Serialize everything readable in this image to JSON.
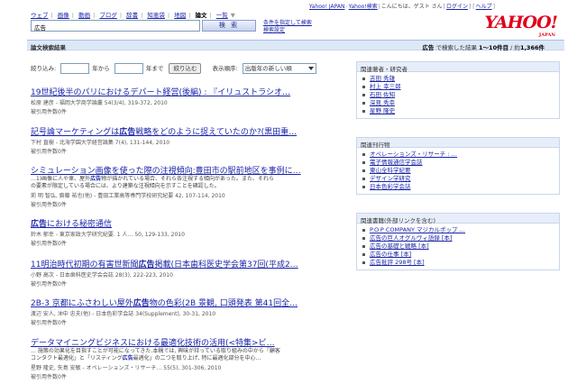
{
  "header": {
    "top_links": [
      "Yahoo! JAPAN",
      "Yahoo!検索",
      "こんにちは、ゲスト さん",
      "ログイン",
      "ヘルプ"
    ],
    "logo": "YAHOO!",
    "logo_sub": "JAPAN",
    "tabs": [
      "ウェブ",
      "画像",
      "動画",
      "ブログ",
      "辞書",
      "知恵袋",
      "地図",
      "論文",
      "一覧"
    ],
    "active_tab": "論文",
    "search_value": "広告",
    "search_button": "検 索",
    "advanced_links": [
      "条件を指定して検索",
      "検索設定"
    ]
  },
  "results_bar": {
    "title": "論文検索結果",
    "query": "広告",
    "summary": "で検索した結果",
    "range": "1〜10件目",
    "sep": " / 約",
    "total": "1,366件"
  },
  "filter": {
    "label": "絞り込み:",
    "from_label": "年から",
    "to_label": "年まで",
    "button": "絞り込む",
    "sort_label": "表示順序:",
    "sort_value": "出版年の新しい順"
  },
  "results": [
    {
      "title": "19世紀後半のパリにおけるデパート経営(後編) : 『イリュストラシオ…",
      "meta": "松原 建彦 - 福岡大学商学論叢 54(3/4), 319-372, 2010",
      "snippet": "",
      "note": "被引用件数0件"
    },
    {
      "title": "記号論マーケティングは広告戦略をどのように捉えていたのか?(黒田重…",
      "meta": "下村 直樹 - 北海学園大学経営論集 7(4), 131-144, 2010",
      "snippet": "",
      "note": "被引用件数0件"
    },
    {
      "title": "シミュレーション画像を使った際の注視傾向:豊田市の駅前地区を事例に…",
      "meta": "荊 明 智弘, 齋藤 祐也(他) - 豊田工業高等専門学校研究紀要 42, 107-114, 2010",
      "snippet": "…1)画像に人や車、屋外広告物が描かれている場合、それら各注視する傾向があった。また、それら\nの要素が限定している場合には、より建築な注視傾向を示すことを確認した。",
      "note": "被引用件数0件"
    },
    {
      "title": "広告における秘密通信",
      "meta": "鈴木 郁幸 - 東京家政大学研究紀要. 1 人… 50, 129-133, 2010",
      "snippet": "",
      "note": "被引用件数0件"
    },
    {
      "title": "11明治時代初期の有害世新聞広告掲載(日本歯科医史学会第37回(平成2…",
      "meta": "小野 高次 - 日本歯科医史学会会誌 28(3), 222-223, 2010",
      "snippet": "",
      "note": "被引用件数0件"
    },
    {
      "title": "2B-3 京都にふさわしい屋外広告物の色彩(2B 景観, 口頭発表 第41回全…",
      "meta": "渡辺 安人, 沖中 忠夫(他) - 日本色彩学会誌 34(Supplement), 30-31, 2010",
      "snippet": "",
      "note": "被引用件数0件"
    },
    {
      "title": "データマイニングビジネスにおける最適化技術の活用(<特集>ビ…",
      "meta": "星野 隆史, 矢島 安敏 - オペレーションズ・リサーチ… 55(5), 301-306, 2010",
      "snippet": "… 施策の効果化を目指すことが可能になってきた.本稿では, 興味が持っている取り組みの中から「顧客\nコンタクト最適化」と「リスティング広告最適化」の二つを取り上げ, 特に最適化部分を中心…",
      "note": "被引用件数0件"
    }
  ],
  "sidebar": {
    "authors": {
      "heading": "関連著者・研究者",
      "items": [
        "吉田 秀雄",
        "村上 幸三郎",
        "石田 佐知",
        "深見 秀幸",
        "星野 隆史"
      ]
    },
    "publications": {
      "heading": "関連刊行物",
      "items": [
        "オペレーションズ・リサーチ : …",
        "電子情報通信学会誌",
        "東山全科学紀要",
        "デザイン学研究",
        "日本色彩学会誌"
      ]
    },
    "books": {
      "heading": "関連書籍(外部リンクを含む)",
      "items": [
        "P.O.P COMPANY マジカルポップ …",
        "広告の巨人オグルヴィ語録 [本]",
        "広告の基礎と戦略 [本]",
        "広告の仕事 [本]",
        "広告批評 298号 [本]"
      ]
    }
  }
}
